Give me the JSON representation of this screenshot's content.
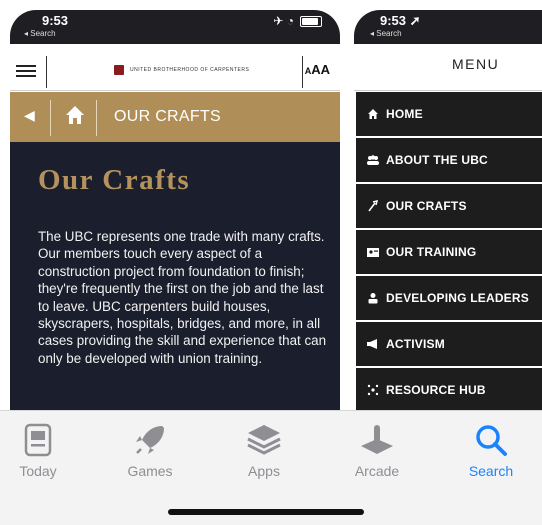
{
  "phone1": {
    "status": {
      "time": "9:53",
      "back_label": "◂ Search",
      "signal": "✈ ◔"
    },
    "header": {
      "logo_text": "UNITED BROTHERHOOD OF CARPENTERS",
      "text_size_label": "AA",
      "text_size_prefix": "A"
    },
    "breadcrumb": {
      "label": "OUR CRAFTS"
    },
    "content": {
      "title": "Our Crafts",
      "body": "The UBC represents one trade with many crafts. Our members touch every aspect of a construction project from foundation to finish; they're frequently the first on the job and the last to leave. UBC carpenters build houses, skyscrapers, hospitals, bridges, and more, in all cases providing the skill and experience that can only be developed with union training."
    }
  },
  "phone2": {
    "status": {
      "time": "9:53 ➚",
      "back_label": "◂ Search"
    },
    "menu_title": "MENU",
    "menu_items": [
      {
        "label": "HOME",
        "icon": "home-icon"
      },
      {
        "label": "ABOUT THE UBC",
        "icon": "group-icon"
      },
      {
        "label": "OUR CRAFTS",
        "icon": "tools-icon"
      },
      {
        "label": "OUR TRAINING",
        "icon": "training-icon"
      },
      {
        "label": "DEVELOPING LEADERS",
        "icon": "person-icon"
      },
      {
        "label": "ACTIVISM",
        "icon": "megaphone-icon"
      },
      {
        "label": "RESOURCE HUB",
        "icon": "hub-icon"
      }
    ]
  },
  "tabbar": {
    "tabs": [
      {
        "label": "Today",
        "icon": "today-icon",
        "active": false
      },
      {
        "label": "Games",
        "icon": "rocket-icon",
        "active": false
      },
      {
        "label": "Apps",
        "icon": "layers-icon",
        "active": false
      },
      {
        "label": "Arcade",
        "icon": "joystick-icon",
        "active": false
      },
      {
        "label": "Search",
        "icon": "search-icon",
        "active": true
      }
    ],
    "colors": {
      "active": "#1a84ff",
      "inactive": "#8e8e93"
    }
  },
  "colors": {
    "gold": "#b08e58",
    "navy": "#1b1f2d",
    "menu_bg": "#1d1d1d"
  }
}
